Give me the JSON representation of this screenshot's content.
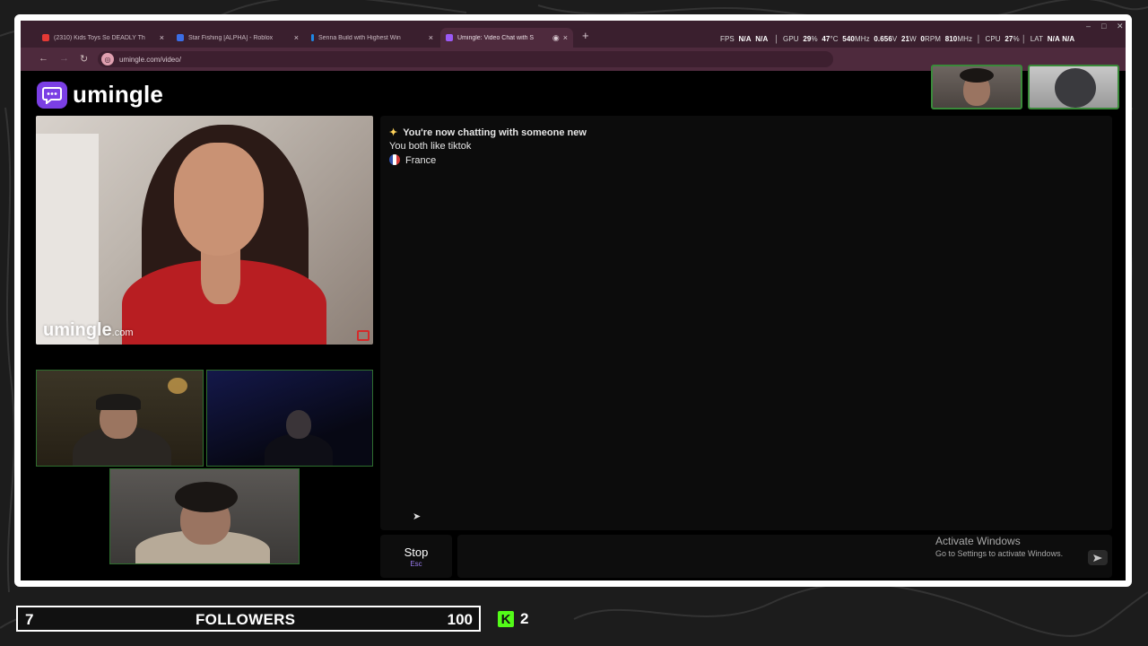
{
  "browser": {
    "tabs": [
      {
        "label": "(2310) Kids Toys So DEADLY Th",
        "favicon_color": "#e53935"
      },
      {
        "label": "Star Fishing [ALPHA] - Roblox",
        "favicon_color": "#3b6ee6"
      },
      {
        "label": "Senna Build with Highest Win",
        "favicon_color": "#1e88e5"
      },
      {
        "label": "Umingle: Video Chat with S",
        "favicon_color": "#9b59f5",
        "active": true
      }
    ],
    "close_glyph": "×",
    "new_tab_glyph": "+",
    "url": "umingle.com/video/",
    "nav": {
      "back": "←",
      "forward": "→",
      "reload": "↻"
    }
  },
  "hud": {
    "fps_label": "FPS",
    "fps_value": "N/A",
    "fps_value2": "N/A",
    "gpu_label": "GPU",
    "gpu_usage": "29",
    "gpu_usage_unit": "%",
    "gpu_temp": "47",
    "gpu_temp_unit": "°C",
    "gpu_clock": "540",
    "gpu_clock_unit": "MHz",
    "gpu_voltage": "0.656",
    "gpu_voltage_unit": "V",
    "gpu_power": "21",
    "gpu_power_unit": "W",
    "gpu_fan": "0",
    "gpu_fan_unit": "RPM",
    "gpu_mem_clock": "810",
    "gpu_mem_clock_unit": "MHz",
    "cpu_label": "CPU",
    "cpu_usage": "27",
    "cpu_usage_unit": "%",
    "lat_label": "LAT",
    "lat_value": "N/A",
    "lat_value2": "N/A"
  },
  "app": {
    "logo_text": "umingle",
    "accent_color": "#7b3fe4",
    "watermark": "umingle",
    "watermark_suffix": ".com"
  },
  "chat": {
    "system_message": "You're now chatting with someone new",
    "interest_message": "You both like tiktok",
    "country": "France"
  },
  "controls": {
    "stop_label": "Stop",
    "stop_hotkey": "Esc",
    "message_placeholder": ""
  },
  "windows_notice": {
    "title": "Activate Windows",
    "subtitle": "Go to Settings to activate Windows."
  },
  "stream_overlay": {
    "followers_current": "7",
    "followers_label": "FOLLOWERS",
    "followers_goal": "100",
    "followers_progress": 0.07,
    "kick_logo": "K",
    "kick_count": "2",
    "kick_color": "#53fc18",
    "frame_border_color": "#ffffff"
  }
}
